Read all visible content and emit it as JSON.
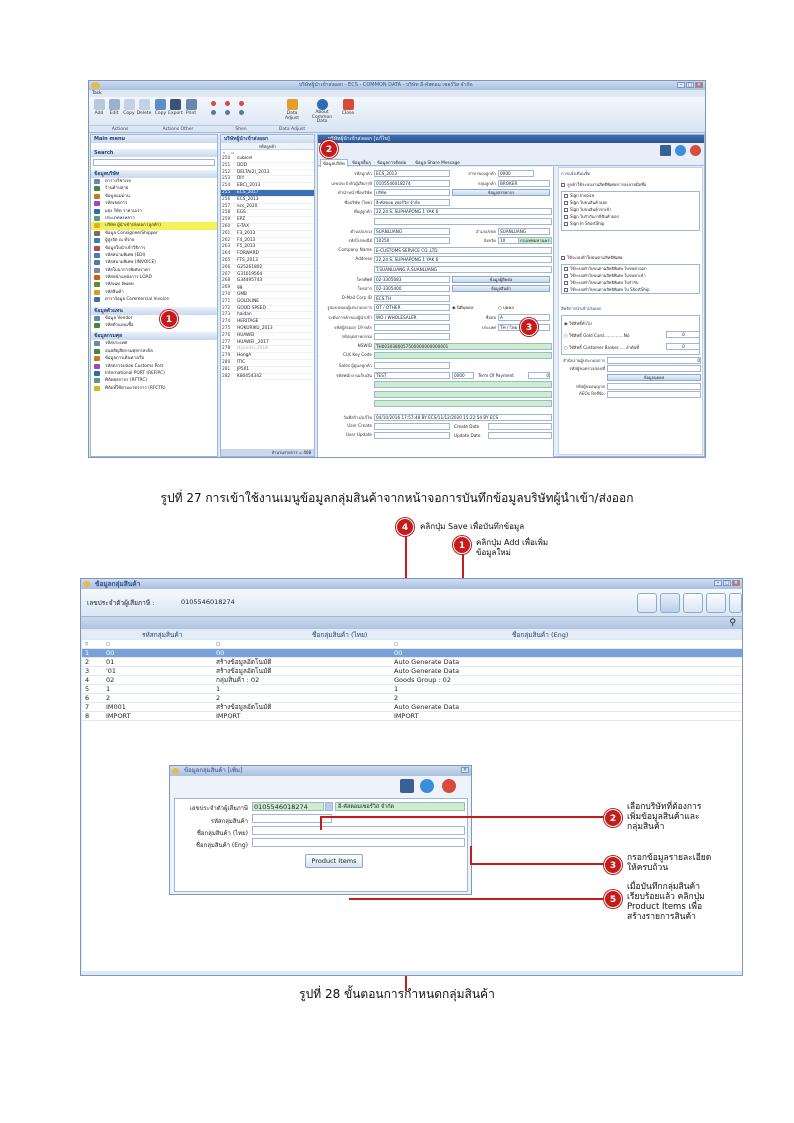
{
  "fig27": {
    "window_title": "บริษัทผู้นำเข้าส่งออก - ECS - COMMON DATA - บริษัท อี-คัสตอม เซอร์วิส จำกัด",
    "tab": "Task",
    "ribbon": {
      "buttons": [
        "Add",
        "Edit",
        "Copy",
        "Delete",
        "Copy",
        "Export",
        "Print",
        "Data Adjust",
        "About\nCommon Data",
        "Close"
      ],
      "groups": [
        "Actions",
        "Actions Other",
        "Shen",
        "Data Adjust"
      ]
    },
    "main_menu_label": "Main menu",
    "search_label": "Search",
    "nav_section1": "ข้อมูลบริษัท",
    "nav_items1": [
      "ตารางรีชาเรย",
      "ร้านค้าปลาย",
      "ข้อมูลแม่ม่าน",
      "รหัสเขตการ",
      "ผลุ่ง รีษัท ราคาเอร่า",
      "ประเภทหงหลาว",
      "บริษัท ผู้นำเข้า/ส่งออก (ลูกค้า)",
      "ข้อมูล Consignee/Shipper",
      "ผู้สูงจัด ณ ที่จ่าย",
      "ข้อมูลใบนำเข้าวิธิการ",
      "รหัสสนามพิเศษ (EDI)",
      "รหัสสนามพิเศษ (INVOICE)",
      "รหัสใบนาการพิเศษราคา",
      "รหัสหน้าแหล่งการ LOAD",
      "รหัสเนท อัพเดท",
      "รหัสสินค้า",
      "ตาราง้อมูล Commercial Invoice"
    ],
    "nav_section2": "ข้อมูลตัวแทน",
    "nav_items2": [
      "ข้อมูล Vendor",
      "รหัสตัวแทนเชื้อ"
    ],
    "nav_section3": "ข้อมูลกรมศุล",
    "nav_items3": [
      "รหัสประเทศ",
      "อนุสสัญสิตกรมศุลกรสงบิล",
      "ข้อมูลการเดินทางเรือ",
      "รหัสตรวจปล่อย Customs Port",
      "International PORT (REFIPC)",
      "พิกัดศุลกากร (RFTRC)",
      "พิกัดที่ใช้ตามมาตรการ (RFCTR)"
    ],
    "list_title": "บริษัทผู้นำเข้าส่งออก",
    "list_col": "รหัสลูกค้า",
    "list_rows": [
      [
        "250",
        "cubicel"
      ],
      [
        "251",
        "DDD"
      ],
      [
        "252",
        "DELTA(2)_2013"
      ],
      [
        "253",
        "DIY"
      ],
      [
        "254",
        "EBC)_2013"
      ],
      [
        "255",
        "ECS_2017"
      ],
      [
        "256",
        "ECS_2013"
      ],
      [
        "257",
        "ecs_2020"
      ],
      [
        "258",
        "EGS"
      ],
      [
        "259",
        "EPZ"
      ],
      [
        "260",
        "E-TAX"
      ],
      [
        "261",
        "F3_2013"
      ],
      [
        "262",
        "F4_2013"
      ],
      [
        "263",
        "F5_2013"
      ],
      [
        "264",
        "FORWARD"
      ],
      [
        "265",
        "FTS_2013"
      ],
      [
        "266",
        "G25261802"
      ],
      [
        "267",
        "G31019564"
      ],
      [
        "268",
        "G34495743"
      ],
      [
        "269",
        "gg"
      ],
      [
        "270",
        "GMB"
      ],
      [
        "271",
        "GOLDLINE"
      ],
      [
        "272",
        "GOOD SPEED"
      ],
      [
        "273",
        "haidan"
      ],
      [
        "274",
        "HERITAGE"
      ],
      [
        "275",
        "HOKURIKU_2013"
      ],
      [
        "276",
        "HUAWEI"
      ],
      [
        "277",
        "HUAWEI _2017"
      ],
      [
        "278",
        "Hyundai_2018"
      ],
      [
        "279",
        "HongA"
      ],
      [
        "280",
        "ITIC"
      ],
      [
        "281",
        "JP501"
      ],
      [
        "282",
        "K80454342"
      ]
    ],
    "list_footer": "จำนวนรายการ = 408",
    "detail_title": "บริษัทผู้นำเข้าส่งออก [แก้ไข]",
    "detail_tabs": [
      "ข้อมูลบริษัท",
      "ข้อมูลอื่นๆ",
      "ข้อมูลการติดต่อ",
      "ข้อมูล Share Message"
    ],
    "fields": [
      {
        "label": "รหัสลูกค้า",
        "value": "ECS_2013"
      },
      {
        "label": "เลขประจำตัวผู้เสียภาษี",
        "value": "0105546018274"
      },
      {
        "label": "คำนำหน้าชื่อบริษัท",
        "value": "บริษัท"
      },
      {
        "label": "ชื่อบริษัท (ไทย)",
        "value": "อี-คัสตอม เซอร์วิส จำกัด"
      },
      {
        "label": "ที่อยู่ลูกค้า",
        "value": "22,24 S. SUPHAPONG 1 YAK 6"
      },
      {
        "label": "",
        "value": ""
      },
      {
        "label": "ตำบล/แขวง",
        "value": "SUANLUANG"
      },
      {
        "label": "รหัสไปรษณีย์",
        "value": "10250"
      },
      {
        "label": "Company Name",
        "value": "E-CUSTOMS SERVICE CO.,LTD."
      },
      {
        "label": "Address",
        "value": "22,24 S. SUPHAPONG 1 YAK 6"
      },
      {
        "label": "",
        "value": "T.SUANLUANG  A.SUANLUANG"
      },
      {
        "label": "โทรศัพท์",
        "value": "02-3305083"
      },
      {
        "label": "โทรสาร",
        "value": "02-3305400"
      },
      {
        "label": "D-Mail Corp ID",
        "value": "ECS.TH"
      },
      {
        "label": "รูปแบบของผู้ประกอบการ",
        "value": "OT / OTHER"
      },
      {
        "label": "ระดับการค้าของผู้นำเข้า",
        "value": "WO / WHOLESALER"
      },
      {
        "label": "รหัสผู้ส่งออก 19 หลัก",
        "value": ""
      },
      {
        "label": "รหัสอุตสาหกรรม",
        "value": ""
      },
      {
        "label": "NSWID",
        "value": "TH0030380057500000000000001"
      },
      {
        "label": "CLK Key Code",
        "value": ""
      },
      {
        "label": "Sales ผู้ดูแลลูกค้า",
        "value": ""
      },
      {
        "label": "รหัสพนักงานเก็บเงิน",
        "value": "TEST"
      }
    ],
    "right_fields": [
      {
        "label": "สาขาของลูกค้า",
        "value": "0000"
      },
      {
        "label": "กลุ่มลูกค้า",
        "value": "BROKER"
      },
      {
        "label": "อำเภอ/เขต",
        "value": "SUANLUANG"
      },
      {
        "label": "จังหวัด",
        "value": "10"
      },
      {
        "label": "ประเทศ",
        "value": "TH / ไทย"
      },
      {
        "label": "ชื่อย่อ",
        "value": "A"
      }
    ],
    "province_value": "กรุงเทพมหานคร",
    "btn_tax_info": "ข้อมูลสรรพากร",
    "btn_contact": "ข้อมูลผู้ติดต่อ",
    "btn_product_group": "ข้อมูลสินค้า",
    "radio_juristic": "นิติบุคคล",
    "radio_person": "บุคคล",
    "credit_value": "0000",
    "term_label": "Term Of Payment",
    "term_value": "0",
    "created_text": "04/10/2016 17:57:48 BY ECS/11/12/2020 15:22:54 BY ECS",
    "user_create_label": "User Create",
    "create_date_label": "Create Date",
    "user_update_label": "User Update",
    "update_date_label": "Update Date",
    "created_by_label": "วันที่สร้าง/แก้ไข",
    "right_panel_title1": "การแจ้งเตือนชื่อ",
    "right_panel_sub1": "ลูกค้าใช้ระบบงานสิทธิพิเศษการลงลายมือชื่อ",
    "sign_items": [
      "Sign Invoice",
      "Sign ใบขนสินค้าออก",
      "Sign ใบขนสินค้าขาเข้า",
      "Sign ใบกำกับภาษีสินค้าออก",
      "Sign In ShortShip"
    ],
    "right_panel_sub2": "ใช้ระบบทำใบขนตามสิทธิพิเศษ",
    "priv_items": [
      "ใช้ระบบทำใบขนตามสิทธิพิเศษ ใบขนขาออก",
      "ใช้ระบบทำใบขนตามสิทธิพิเศษ ใบขนขาเข้า",
      "ใช้ระบบทำใบขนตามสิทธิพิเศษ ใบกำกับ",
      "ใช้ระบบทำใบขนตามสิทธิพิเศษ ใบ ShortShip"
    ],
    "right_panel_title2": "สิทธิการนำเข้า/ส่งออก",
    "priv_opts": [
      "ใช้สิทธิ์ทั่วไป",
      "ใช้สิทธิ์ Gold Card...............No",
      "ใช้สิทธิ์ Customer Broker..... ลำดับที่"
    ],
    "gold_no": "0",
    "broker_no": "0",
    "extra_labels": [
      "สำนักงานผู้ประกอบการ",
      "รหัสผู้ขอตรวจสอบที่",
      "รหัสผู้ขออนุญาต",
      "AEOs RefNo."
    ],
    "extra_value": "0",
    "extra_button": "ข้อมูลบุคคล",
    "caption": "รูปที่ 27 การเข้าใช้งานเมนูข้อมูลกลุ่มสินค้าจากหน้าจอการบันทึกข้อมูลบริษัทผู้นำเข้า/ส่งออก",
    "badges": [
      "1",
      "2",
      "3"
    ]
  },
  "fig28": {
    "callout_save_num": "4",
    "callout_save": "คลิกปุ่ม Save เพื่อบันทึกข้อมูล",
    "callout_add_num": "1",
    "callout_add": "คลิกปุ่ม Add เพื่อเพิ่ม\nข้อมูลใหม่",
    "window_title": "ข้อมูลกลุ่มสินค้า",
    "tax_label": "เลขประจำตัวผู้เสียภาษี :",
    "tax_value": "0105546018274",
    "columns": [
      "รหัสกลุ่มสินค้า",
      "ชื่อกลุ่มสินค้า (ไทย)",
      "ชื่อกลุ่มสินค้า (Eng)"
    ],
    "filter_symbol": "▿",
    "rows": [
      {
        "n": "1",
        "code": "00",
        "th": "00",
        "en": "00"
      },
      {
        "n": "2",
        "code": "01",
        "th": "สร้างข้อมูลอัตโนมัติ",
        "en": "Auto Generate Data"
      },
      {
        "n": "3",
        "code": "'01",
        "th": "สร้างข้อมูลอัตโนมัติ",
        "en": "Auto Generate Data"
      },
      {
        "n": "4",
        "code": "02",
        "th": "กลุ่มสินค้า : 02",
        "en": "Goods Group : 02"
      },
      {
        "n": "5",
        "code": "1",
        "th": "1",
        "en": "1"
      },
      {
        "n": "6",
        "code": "2",
        "th": "2",
        "en": "2"
      },
      {
        "n": "7",
        "code": "IM001",
        "th": "สร้างข้อมูลอัตโนมัติ",
        "en": "Auto Generate Data"
      },
      {
        "n": "8",
        "code": "IMPORT",
        "th": "IMPORT",
        "en": "IMPORT"
      }
    ],
    "dialog_title": "ข้อมูลกลุ่มสินค้า [เพิ่ม]",
    "dlg_tax_label": "เลขประจำตัวผู้เสียภาษี",
    "dlg_tax_value": "0105546018274",
    "dlg_company": "อี-คัสตอมเซอร์วิส จำกัด",
    "dlg_code_label": "รหัสกลุ่มสินค้า",
    "dlg_th_label": "ชื่อกลุ่มสินค้า (ไทย)",
    "dlg_en_label": "ชื่อกลุ่มสินค้า (Eng)",
    "product_items_button": "Product Items",
    "c2_num": "2",
    "c2": "เลือกบริษัทที่ต้องการ\nเพิ่มข้อมูลสินค้าและ\nกลุ่มสินค้า",
    "c3_num": "3",
    "c3": "กรอกข้อมูลรายละเอียด\nให้ครบถ้วน",
    "c5_num": "5",
    "c5": "เมื่อบันทึกกลุ่มสินค้า\nเรียบร้อยแล้ว คลิกปุ่ม\nProduct Items เพื่อ\nสร้างรายการสินค้า",
    "caption": "รูปที่ 28 ขั้นตอนการกำหนดกลุ่มสินค้า"
  }
}
